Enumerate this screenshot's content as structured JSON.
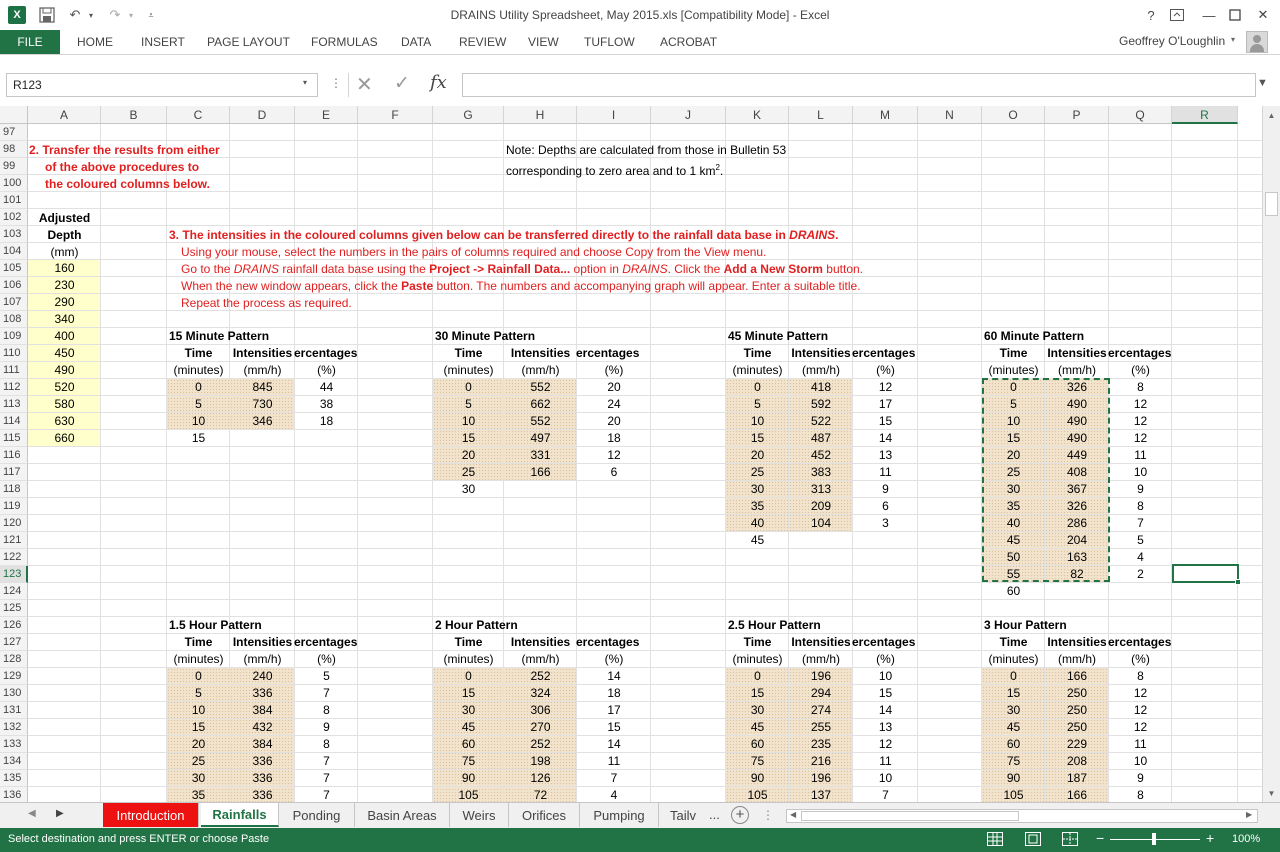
{
  "app": {
    "window_title": "DRAINS Utility Spreadsheet, May 2015.xls  [Compatibility Mode] - Excel",
    "user": "Geoffrey O'Loughlin",
    "logo_text": "X",
    "accent_color": "#217346"
  },
  "ribbon": {
    "file": "FILE",
    "tabs": [
      "HOME",
      "INSERT",
      "PAGE LAYOUT",
      "FORMULAS",
      "DATA",
      "REVIEW",
      "VIEW",
      "TUFLOW",
      "ACROBAT"
    ]
  },
  "formula_bar": {
    "name_box": "R123",
    "fx": "fx",
    "formula": ""
  },
  "sheet": {
    "columns": [
      "A",
      "B",
      "C",
      "D",
      "E",
      "F",
      "G",
      "H",
      "I",
      "J",
      "K",
      "L",
      "M",
      "N",
      "O",
      "P",
      "Q",
      "R"
    ],
    "selected_column": "R",
    "rows": [
      97,
      98,
      99,
      100,
      101,
      102,
      103,
      104,
      105,
      106,
      107,
      108,
      109,
      110,
      111,
      112,
      113,
      114,
      115,
      116,
      117,
      118,
      119,
      120,
      121,
      122,
      123,
      124,
      125,
      126,
      127,
      128,
      129,
      130,
      131,
      132,
      133,
      134,
      135,
      136
    ],
    "selected_row": 123,
    "step2": {
      "line1": "2. Transfer the results from either",
      "line2": "of the above procedures to",
      "line3": "the coloured columns below."
    },
    "note": {
      "line1": "Note: Depths are calculated from those in Bulletin 53",
      "line2_pre": "corresponding to zero area and to 1 km",
      "line2_sup": "2",
      "line2_post": "."
    },
    "depth": {
      "h1": "Adjusted",
      "h2": "Depth",
      "unit": "(mm)",
      "values": [
        "160",
        "230",
        "290",
        "340",
        "400",
        "450",
        "490",
        "520",
        "580",
        "630",
        "660"
      ]
    },
    "step3": {
      "heading": "3. The intensities in the coloured columns given below can be transferred directly to the rainfall data base in ",
      "heading_em": "DRAINS",
      "heading_end": ".",
      "l1": "Using your mouse, select the numbers in the pairs of columns required and choose Copy from the View menu.",
      "l2_a": "Go to the ",
      "l2_b": "DRAINS",
      "l2_c": " rainfall data base using the ",
      "l2_d": "Project -> Rainfall Data...",
      "l2_e": " option in ",
      "l2_f": "DRAINS",
      "l2_g": ".  Click the ",
      "l2_h": "Add a New Storm",
      "l2_i": " button.",
      "l3_a": "When the new window appears, click the ",
      "l3_b": "Paste",
      "l3_c": " button. The numbers and accompanying graph will appear.  Enter a suitable title.",
      "l4": "Repeat the process as required."
    },
    "headers": {
      "time": "Time",
      "intensities": "Intensities",
      "percentages": "Percentages",
      "percentages_clipped": "ercentages",
      "time_unit": "(minutes)",
      "int_unit": "(mm/h)",
      "pct_unit": "(%)"
    },
    "patterns_top": [
      {
        "title": "15 Minute Pattern",
        "time": [
          "0",
          "5",
          "10"
        ],
        "int": [
          "845",
          "730",
          "346"
        ],
        "pct": [
          "44",
          "38",
          "18"
        ],
        "end": "15"
      },
      {
        "title": "30 Minute Pattern",
        "time": [
          "0",
          "5",
          "10",
          "15",
          "20",
          "25"
        ],
        "int": [
          "552",
          "662",
          "552",
          "497",
          "331",
          "166"
        ],
        "pct": [
          "20",
          "24",
          "20",
          "18",
          "12",
          "6"
        ],
        "end": "30"
      },
      {
        "title": "45 Minute Pattern",
        "time": [
          "0",
          "5",
          "10",
          "15",
          "20",
          "25",
          "30",
          "35",
          "40"
        ],
        "int": [
          "418",
          "592",
          "522",
          "487",
          "452",
          "383",
          "313",
          "209",
          "104"
        ],
        "pct": [
          "12",
          "17",
          "15",
          "14",
          "13",
          "11",
          "9",
          "6",
          "3"
        ],
        "end": "45"
      },
      {
        "title": "60 Minute Pattern",
        "time": [
          "0",
          "5",
          "10",
          "15",
          "20",
          "25",
          "30",
          "35",
          "40",
          "45",
          "50",
          "55"
        ],
        "int": [
          "326",
          "490",
          "490",
          "490",
          "449",
          "408",
          "367",
          "326",
          "286",
          "204",
          "163",
          "82"
        ],
        "pct": [
          "8",
          "12",
          "12",
          "12",
          "11",
          "10",
          "9",
          "8",
          "7",
          "5",
          "4",
          "2"
        ],
        "end": "60"
      }
    ],
    "patterns_bottom": [
      {
        "title": "1.5 Hour Pattern",
        "time": [
          "0",
          "5",
          "10",
          "15",
          "20",
          "25",
          "30",
          "35"
        ],
        "int": [
          "240",
          "336",
          "384",
          "432",
          "384",
          "336",
          "336",
          "336"
        ],
        "pct": [
          "5",
          "7",
          "8",
          "9",
          "8",
          "7",
          "7",
          "7"
        ]
      },
      {
        "title": "2 Hour Pattern",
        "time": [
          "0",
          "15",
          "30",
          "45",
          "60",
          "75",
          "90",
          "105"
        ],
        "int": [
          "252",
          "324",
          "306",
          "270",
          "252",
          "198",
          "126",
          "72"
        ],
        "pct": [
          "14",
          "18",
          "17",
          "15",
          "14",
          "11",
          "7",
          "4"
        ]
      },
      {
        "title": "2.5 Hour Pattern",
        "time": [
          "0",
          "15",
          "30",
          "45",
          "60",
          "75",
          "90",
          "105"
        ],
        "int": [
          "196",
          "294",
          "274",
          "255",
          "235",
          "216",
          "196",
          "137"
        ],
        "pct": [
          "10",
          "15",
          "14",
          "13",
          "12",
          "11",
          "10",
          "7"
        ]
      },
      {
        "title": "3 Hour Pattern",
        "time": [
          "0",
          "15",
          "30",
          "45",
          "60",
          "75",
          "90",
          "105"
        ],
        "int": [
          "166",
          "250",
          "250",
          "250",
          "229",
          "208",
          "187",
          "166"
        ],
        "pct": [
          "8",
          "12",
          "12",
          "12",
          "11",
          "10",
          "9",
          "8"
        ]
      }
    ]
  },
  "sheet_tabs": [
    "Introduction",
    "Rainfalls",
    "Ponding",
    "Basin Areas",
    "Weirs",
    "Orifices",
    "Pumping",
    "Tailv",
    "..."
  ],
  "active_tab": "Rainfalls",
  "status": {
    "text": "Select destination and press ENTER or choose Paste",
    "zoom": "100%"
  }
}
